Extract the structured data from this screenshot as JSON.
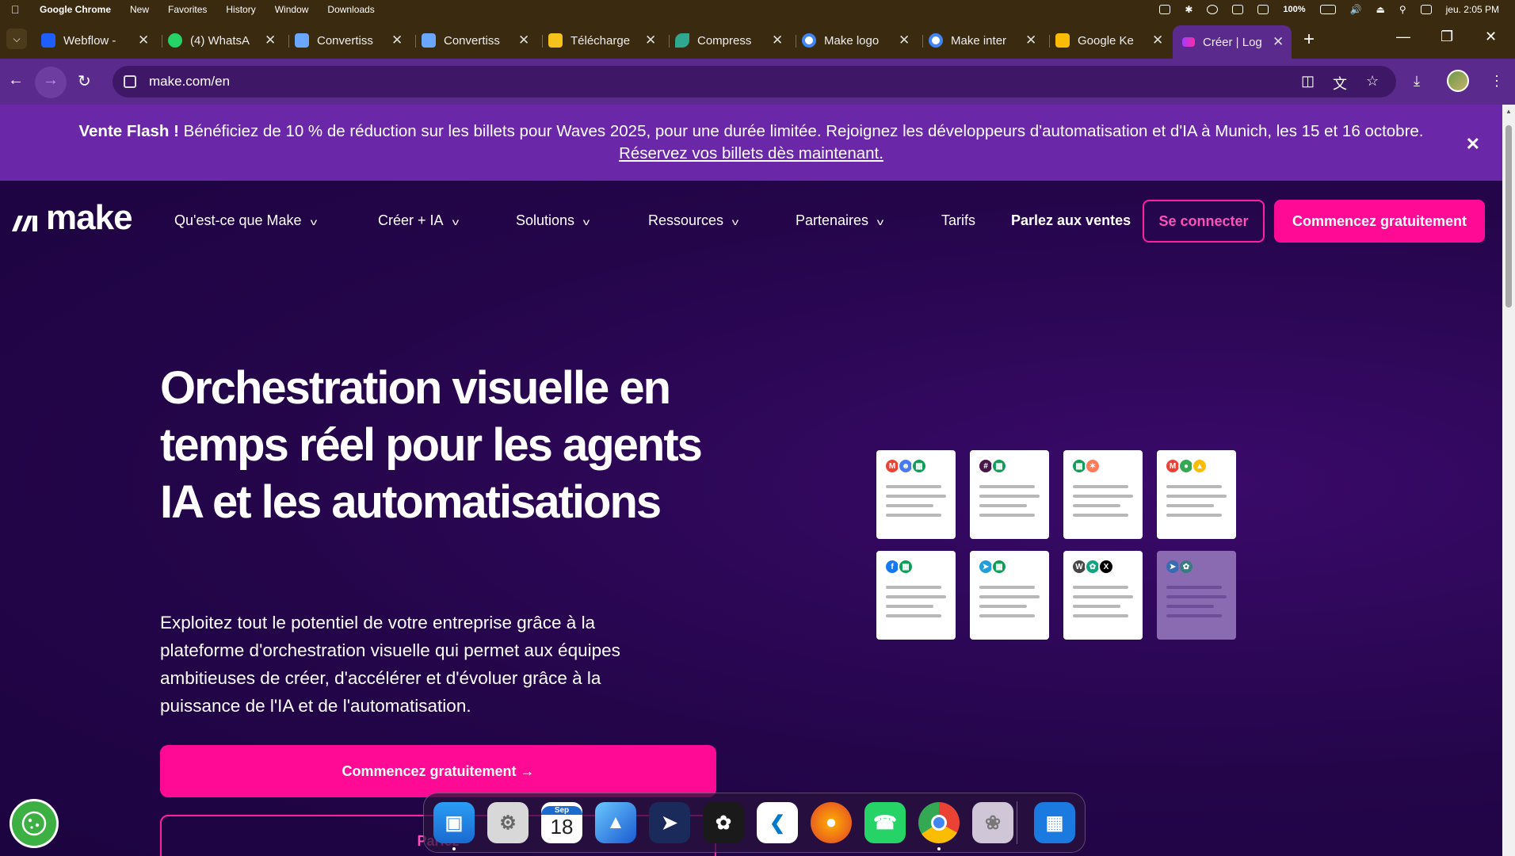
{
  "menubar": {
    "app_name": "Google Chrome",
    "items": [
      "New",
      "Favorites",
      "History",
      "Window",
      "Downloads"
    ],
    "battery": "100%",
    "clock": "jeu. 2:05 PM"
  },
  "tabs": [
    {
      "label": "Webflow -",
      "color": "#1e5eff"
    },
    {
      "label": "(4) WhatsA",
      "color": "#25d366"
    },
    {
      "label": "Convertiss",
      "color": "#6aa8ff"
    },
    {
      "label": "Convertiss",
      "color": "#6aa8ff"
    },
    {
      "label": "Télécharge",
      "color": "#f4c21a"
    },
    {
      "label": "Compress",
      "color": "#2fa890"
    },
    {
      "label": "Make logo",
      "color": "#4285f4"
    },
    {
      "label": "Make inter",
      "color": "#4285f4"
    },
    {
      "label": "Google Ke",
      "color": "#fbbc04"
    },
    {
      "label": "Créer | Log",
      "color": "#a03cff"
    }
  ],
  "address": {
    "url": "make.com/en"
  },
  "banner": {
    "prefix": "Vente Flash !",
    "text": " Bénéficiez de 10 % de réduction sur les billets pour Waves 2025, pour une durée limitée. Rejoignez les développeurs d'automatisation et d'IA à Munich, les 15 et 16 octobre.",
    "link": "Réservez vos billets dès maintenant."
  },
  "nav": {
    "logo": "make",
    "items": [
      "Qu'est-ce que Make",
      "Créer + IA",
      "Solutions",
      "Ressources",
      "Partenaires"
    ],
    "pricing": "Tarifs",
    "sales": "Parlez aux ventes",
    "login": "Se connecter",
    "signup": "Commencez gratuitement"
  },
  "hero": {
    "title": "Orchestration visuelle en temps réel pour les agents IA et les automatisations",
    "subtitle": "Exploitez tout le potentiel de votre entreprise grâce à la plateforme d'orchestration visuelle qui permet aux équipes ambitieuses de créer, d'accélérer et d'évoluer grâce à la puissance de l'IA et de l'automatisation.",
    "cta_primary": "Commencez gratuitement →",
    "cta_secondary": "Parlez"
  },
  "cards": [
    {
      "icons": [
        "gmail-icon",
        "contacts-icon",
        "sheets-icon"
      ],
      "dim": false
    },
    {
      "icons": [
        "slack-icon",
        "sheets-icon"
      ],
      "dim": false
    },
    {
      "icons": [
        "sheets-icon",
        "hubspot-icon"
      ],
      "dim": false
    },
    {
      "icons": [
        "gmail-icon",
        "chrome-icon",
        "drive-icon"
      ],
      "dim": false
    },
    {
      "icons": [
        "facebook-icon",
        "sheets-icon"
      ],
      "dim": false
    },
    {
      "icons": [
        "telegram-icon",
        "sheets-icon"
      ],
      "dim": false
    },
    {
      "icons": [
        "wordpress-icon",
        "openai-icon",
        "x-icon"
      ],
      "dim": false
    },
    {
      "icons": [
        "telegram-icon",
        "openai-icon"
      ],
      "dim": true
    }
  ],
  "dock": {
    "calendar_month": "Sep",
    "calendar_day": "18",
    "apps": [
      "finder-icon",
      "settings-icon",
      "calendar-icon",
      "preview-icon",
      "rocket-icon",
      "chatgpt-icon",
      "vscode-icon",
      "firefox-icon",
      "whatsapp-icon",
      "chrome-icon",
      "gallery-icon",
      "windows-icon"
    ]
  }
}
